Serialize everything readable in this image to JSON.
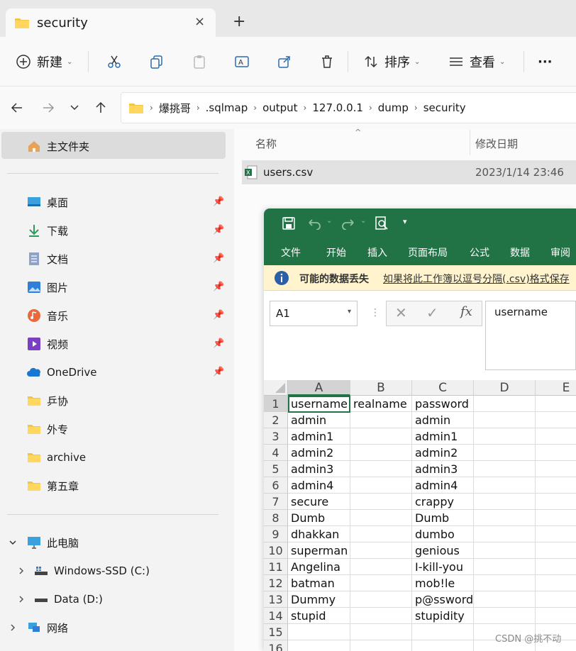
{
  "tab": {
    "title": "security",
    "close": "×",
    "new_tab": "+"
  },
  "toolbar": {
    "new_label": "新建",
    "sort_label": "排序",
    "view_label": "查看",
    "more": "···"
  },
  "address": {
    "crumbs": [
      "爆挑哥",
      ".sqlmap",
      "output",
      "127.0.0.1",
      "dump",
      "security"
    ]
  },
  "sidebar": {
    "home": "主文件夹",
    "quick": [
      {
        "label": "桌面",
        "icon": "desktop-icon"
      },
      {
        "label": "下载",
        "icon": "download-icon"
      },
      {
        "label": "文档",
        "icon": "document-icon"
      },
      {
        "label": "图片",
        "icon": "pictures-icon"
      },
      {
        "label": "音乐",
        "icon": "music-icon"
      },
      {
        "label": "视频",
        "icon": "video-icon"
      },
      {
        "label": "OneDrive",
        "icon": "onedrive-icon"
      },
      {
        "label": "乒协",
        "icon": "folder-icon"
      },
      {
        "label": "外专",
        "icon": "folder-icon"
      },
      {
        "label": "archive",
        "icon": "folder-icon"
      },
      {
        "label": "第五章",
        "icon": "folder-icon"
      }
    ],
    "this_pc": "此电脑",
    "drives": [
      "Windows-SSD (C:)",
      "Data (D:)"
    ],
    "network": "网络"
  },
  "files": {
    "columns": {
      "name": "名称",
      "modified": "修改日期"
    },
    "rows": [
      {
        "name": "users.csv",
        "modified": "2023/1/14 23:46"
      }
    ]
  },
  "excel": {
    "ribbon_tabs": [
      "文件",
      "开始",
      "插入",
      "页面布局",
      "公式",
      "数据",
      "审阅"
    ],
    "warning": {
      "title": "可能的数据丢失",
      "message": "如果将此工作簿以逗号分隔(.csv)格式保存"
    },
    "name_box": "A1",
    "fx": "fx",
    "formula": "username",
    "columns": [
      "A",
      "B",
      "C",
      "D",
      "E"
    ],
    "rows": [
      [
        "username",
        "realname",
        "password"
      ],
      [
        "admin",
        "",
        "admin"
      ],
      [
        "admin1",
        "",
        "admin1"
      ],
      [
        "admin2",
        "",
        "admin2"
      ],
      [
        "admin3",
        "",
        "admin3"
      ],
      [
        "admin4",
        "",
        "admin4"
      ],
      [
        "secure",
        "",
        "crappy"
      ],
      [
        "Dumb",
        "",
        "Dumb"
      ],
      [
        "dhakkan",
        "",
        "dumbo"
      ],
      [
        "superman",
        "",
        "genious"
      ],
      [
        "Angelina",
        "",
        "I-kill-you"
      ],
      [
        "batman",
        "",
        "mob!le"
      ],
      [
        "Dummy",
        "",
        "p@ssword"
      ],
      [
        "stupid",
        "",
        "stupidity"
      ],
      [
        "",
        "",
        ""
      ],
      [
        "",
        "",
        ""
      ]
    ]
  },
  "watermark": "CSDN @挑不动",
  "colors": {
    "excel_green": "#217346",
    "warning_bg": "#fff4ce",
    "folder": "#f4c542"
  }
}
